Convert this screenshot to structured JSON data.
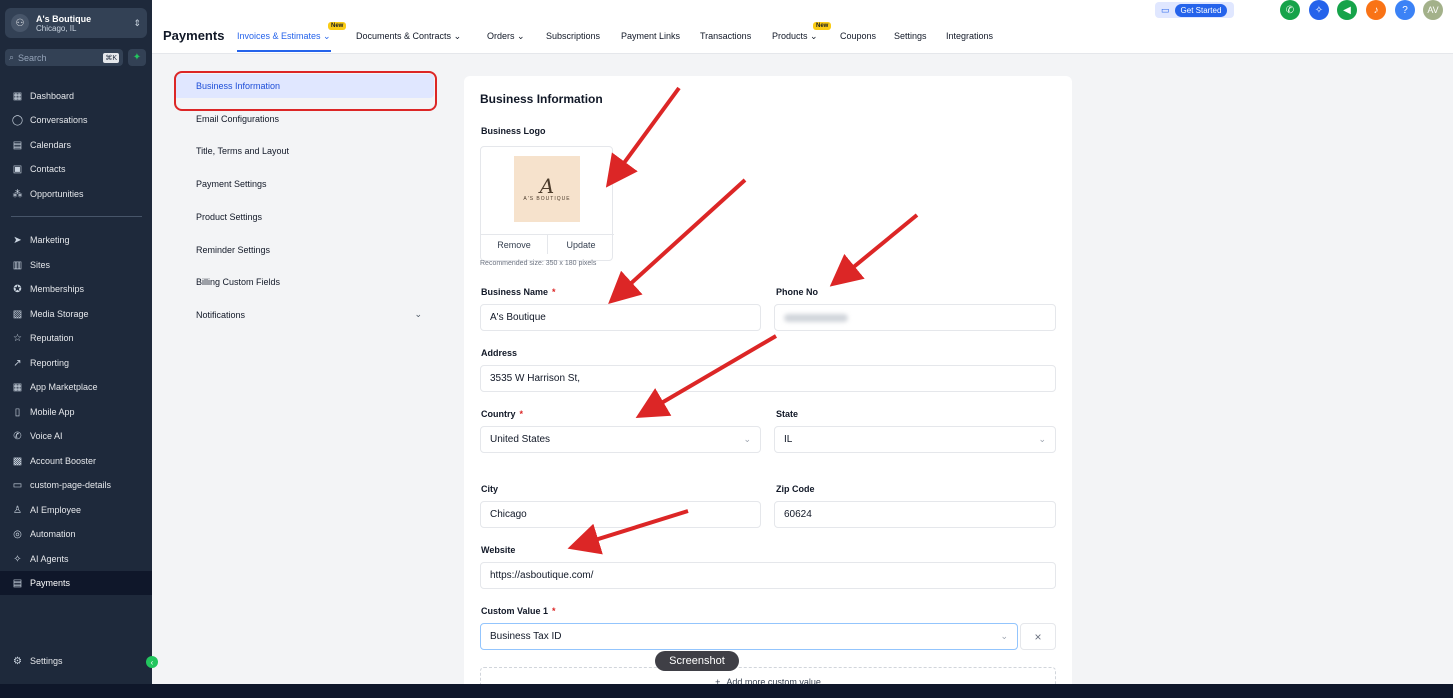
{
  "sidebar": {
    "location": {
      "name": "A's Boutique",
      "city": "Chicago, IL"
    },
    "search": {
      "placeholder": "Search",
      "shortcut": "⌘K"
    },
    "items": [
      {
        "label": "Dashboard",
        "icon": "dashboard-icon"
      },
      {
        "label": "Conversations",
        "icon": "chat-icon"
      },
      {
        "label": "Calendars",
        "icon": "calendar-icon"
      },
      {
        "label": "Contacts",
        "icon": "contacts-icon"
      },
      {
        "label": "Opportunities",
        "icon": "opportunities-icon"
      },
      {
        "label": "Marketing",
        "icon": "send-icon"
      },
      {
        "label": "Sites",
        "icon": "sites-icon"
      },
      {
        "label": "Memberships",
        "icon": "badge-icon"
      },
      {
        "label": "Media Storage",
        "icon": "image-icon"
      },
      {
        "label": "Reputation",
        "icon": "star-icon"
      },
      {
        "label": "Reporting",
        "icon": "chart-icon"
      },
      {
        "label": "App Marketplace",
        "icon": "grid-icon"
      },
      {
        "label": "Mobile App",
        "icon": "mobile-icon"
      },
      {
        "label": "Voice AI",
        "icon": "phone-icon"
      },
      {
        "label": "Account Booster",
        "icon": "booster-icon"
      },
      {
        "label": "custom-page-details",
        "icon": "page-icon"
      },
      {
        "label": "AI Employee",
        "icon": "person-icon"
      },
      {
        "label": "Automation",
        "icon": "automation-icon"
      },
      {
        "label": "AI Agents",
        "icon": "sparkle-icon"
      },
      {
        "label": "Payments",
        "icon": "receipt-icon"
      }
    ],
    "settings": "Settings"
  },
  "header": {
    "title": "Payments",
    "tabs": [
      "Invoices & Estimates",
      "Documents & Contracts",
      "Orders",
      "Subscriptions",
      "Payment Links",
      "Transactions",
      "Products",
      "Coupons",
      "Settings",
      "Integrations"
    ],
    "new_badge": "New",
    "get_started": "Get Started",
    "avatar": "AV",
    "help": "?"
  },
  "subnav": [
    "Business Information",
    "Email Configurations",
    "Title, Terms and Layout",
    "Payment Settings",
    "Product Settings",
    "Reminder Settings",
    "Billing Custom Fields",
    "Notifications"
  ],
  "form": {
    "title": "Business Information",
    "logo_label": "Business Logo",
    "logo_text": "A'S BOUTIQUE",
    "logo_letter": "A",
    "remove": "Remove",
    "update": "Update",
    "recommended": "Recommended size: 350 x 180 pixels",
    "business_name_label": "Business Name",
    "business_name": "A's Boutique",
    "phone_label": "Phone No",
    "address_label": "Address",
    "address": "3535 W Harrison St,",
    "country_label": "Country",
    "country": "United States",
    "state_label": "State",
    "state": "IL",
    "city_label": "City",
    "city": "Chicago",
    "zip_label": "Zip Code",
    "zip": "60624",
    "website_label": "Website",
    "website": "https://asboutique.com/",
    "custom_label": "Custom Value 1",
    "custom_value": "Business Tax ID",
    "add_more": "Add more custom value",
    "required": "*"
  },
  "tooltip": "Screenshot",
  "colors": {
    "accent": "#2563eb",
    "annotation": "#dc2626",
    "sidebar": "#1e293b"
  }
}
